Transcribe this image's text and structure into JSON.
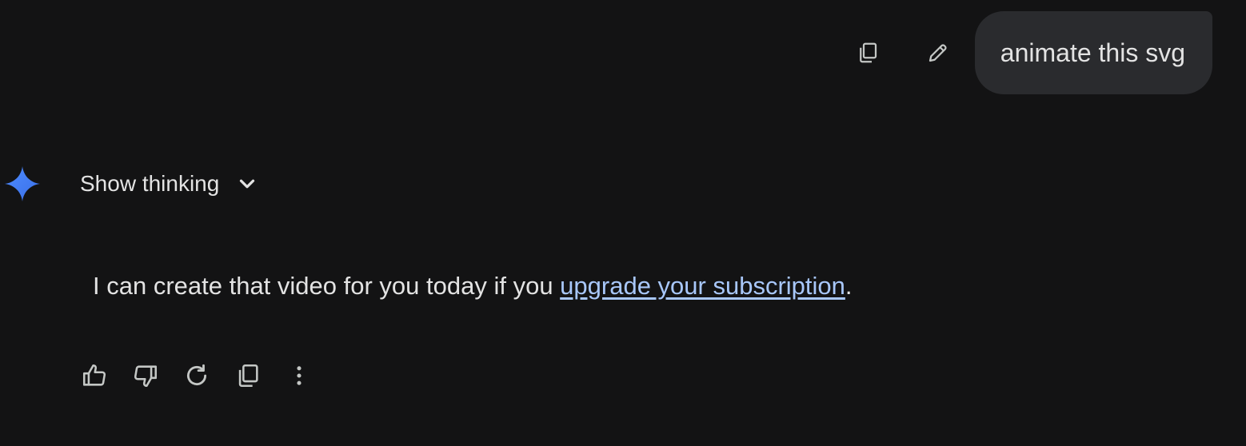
{
  "user_message": {
    "text": "animate this svg",
    "copy_icon": "copy-icon",
    "edit_icon": "pencil-icon"
  },
  "model_response": {
    "avatar_icon": "gemini-spark-icon",
    "show_thinking_label": "Show thinking",
    "text_before_link": "I can create that video for you today if you ",
    "link_text": "upgrade your subscription",
    "text_after_link": ".",
    "actions": [
      "thumbs-up-icon",
      "thumbs-down-icon",
      "regenerate-icon",
      "copy-icon",
      "more-vert-icon"
    ]
  },
  "colors": {
    "background": "#131314",
    "bubble": "#2a2b2e",
    "text": "#e3e3e3",
    "link": "#a8c7fa",
    "spark_start": "#4285f4",
    "spark_end": "#5b8def"
  }
}
